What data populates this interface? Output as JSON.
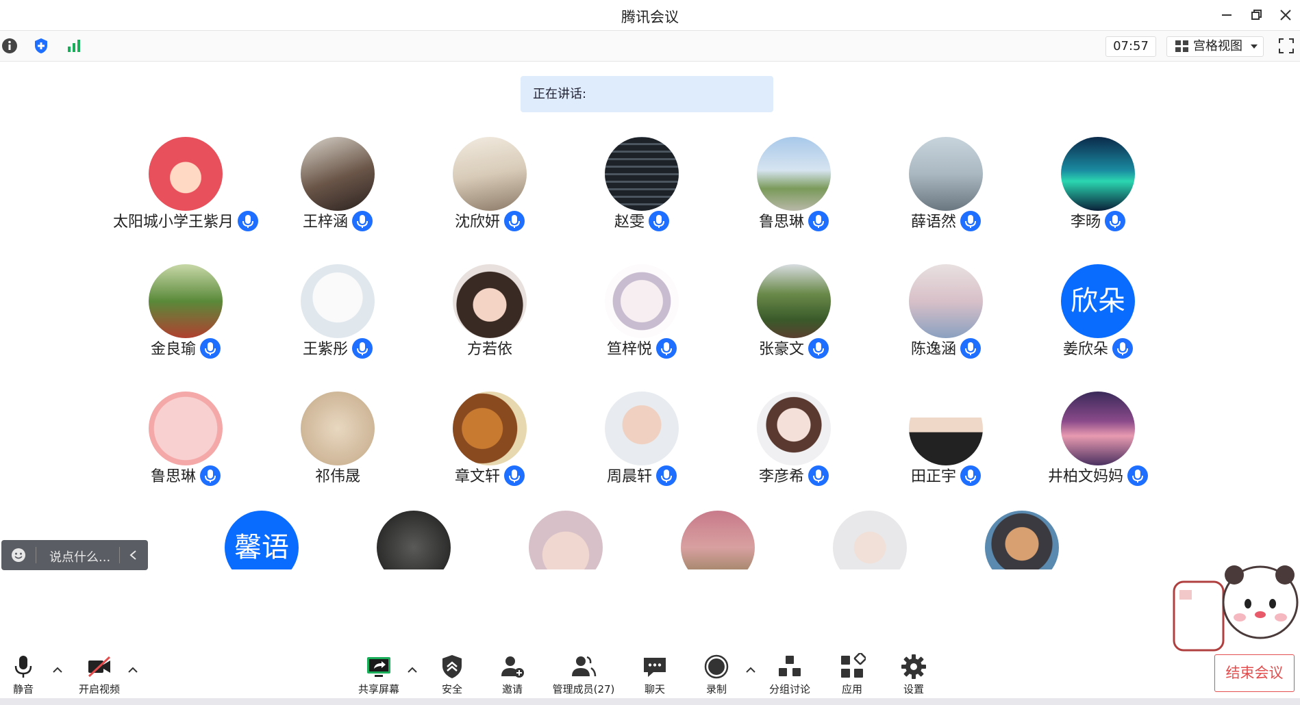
{
  "window": {
    "title": "腾讯会议"
  },
  "topbar": {
    "timer": "07:57",
    "view_label": "宫格视图"
  },
  "speaking": {
    "label": "正在讲话:"
  },
  "participants": [
    {
      "name": "太阳城小学王紫月"
    },
    {
      "name": "王梓涵"
    },
    {
      "name": "沈欣妍"
    },
    {
      "name": "赵雯"
    },
    {
      "name": "鲁思琳"
    },
    {
      "name": "薛语然"
    },
    {
      "name": "李旸"
    },
    {
      "name": "金良瑜"
    },
    {
      "name": "王紫彤"
    },
    {
      "name": "方若依"
    },
    {
      "name": "笪梓悦"
    },
    {
      "name": "张豪文"
    },
    {
      "name": "陈逸涵"
    },
    {
      "name": "姜欣朵",
      "avatar_text": "欣朵"
    },
    {
      "name": "鲁思琳"
    },
    {
      "name": "祁伟晟"
    },
    {
      "name": "章文轩"
    },
    {
      "name": "周晨轩"
    },
    {
      "name": "李彦希"
    },
    {
      "name": "田正宇"
    },
    {
      "name": "井柏文妈妈"
    },
    {
      "avatar_text": "馨语"
    },
    {},
    {},
    {},
    {},
    {}
  ],
  "chat": {
    "placeholder": "说点什么..."
  },
  "toolbar": {
    "mute": "静音",
    "video": "开启视频",
    "share": "共享屏幕",
    "security": "安全",
    "invite": "邀请",
    "members": "管理成员(27)",
    "chat": "聊天",
    "record": "录制",
    "breakout": "分组讨论",
    "apps": "应用",
    "settings": "设置"
  },
  "end_meeting": "结束会议",
  "colors": {
    "accent": "#1e6fff",
    "end": "#e34d4d",
    "share": "#1aad5a"
  }
}
